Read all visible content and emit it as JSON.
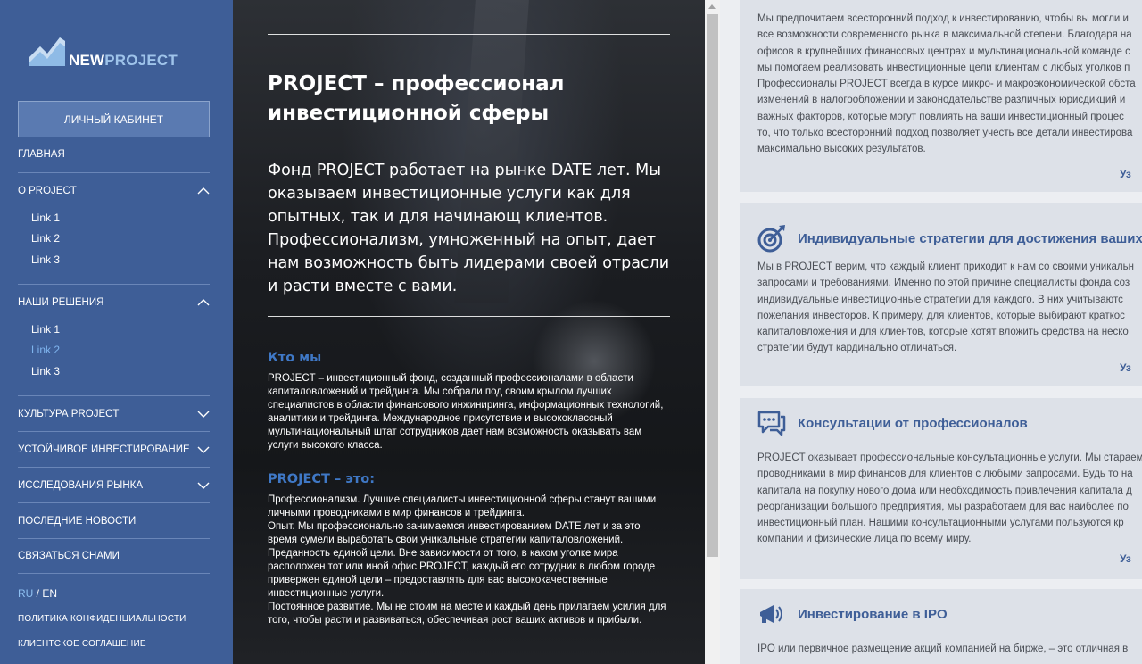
{
  "brand": {
    "part1": "NEW",
    "part2": "PROJECT"
  },
  "sidebar": {
    "cabinet_label": "ЛИЧНЫЙ КАБИНЕТ",
    "main_label": "ГЛАВНАЯ",
    "about": {
      "label": "О PROJECT",
      "links": [
        "Link 1",
        "Link 2",
        "Link 3"
      ]
    },
    "solutions": {
      "label": "НАШИ РЕШЕНИЯ",
      "links": [
        "Link 1",
        "Link 2",
        "Link 3"
      ],
      "active_index": 1
    },
    "culture_label": "КУЛЬТУРА PROJECT",
    "sustainable_label": "УСТОЙЧИВОЕ ИНВЕСТИРОВАНИЕ",
    "research_label": "ИССЛЕДОВАНИЯ РЫНКА",
    "news_label": "ПОСЛЕДНИЕ НОВОСТИ",
    "contact_label": "СВЯЗАТЬСЯ СНАМИ",
    "lang_current": "RU",
    "lang_sep": " / ",
    "lang_other": "EN",
    "privacy_label": "ПОЛИТИКА КОНФИДЕНЦИАЛЬНОСТИ",
    "agreement_label": "КЛИЕНТСКОЕ СОГЛАШЕНИЕ"
  },
  "hero": {
    "title": "PROJECT – профессионал инвестиционной сферы",
    "lead": "Фонд PROJECT работает на рынке DATE лет. Мы оказываем инвестиционные услуги как для опытных, так и для начинающ клиентов. Профессионализм, умноженный на опыт, дает нам возможность быть лидерами своей отрасли и расти вместе с вами.",
    "who_title": "Кто мы",
    "who_text": "PROJECT – инвестиционный фонд, созданный профессионалами в области капиталовложений и трейдинга. Мы собрали под своим крылом лучших специалистов в области финансового инжиниринга, информационных технологий, аналитики и трейдинга. Международное присутствие и высококлассный мультинациональный штат сотрудников дает нам возможность оказывать вам услуги высокого класса.",
    "is_title": "PROJECT – это:",
    "is_lines": [
      "Профессионализм. Лучшие специалисты инвестиционной сферы станут вашими личными проводниками в мир финансов и трейдинга.",
      "Опыт. Мы профессионально занимаемся инвестированием DATE лет и за это время сумели выработать свои уникальные стратегии капиталовложений.",
      "Преданность единой цели. Вне зависимости от того, в каком уголке мира расположен тот или иной офис PROJECT, каждый его сотрудник в любом городе привержен единой цели – предоставлять для вас высококачественные инвестиционные услуги.",
      "Постоянное развитие. Мы не стоим на месте и каждый день прилагаем усилия для того, чтобы расти и развиваться, обеспечивая рост ваших активов и прибыли."
    ]
  },
  "cards": [
    {
      "icon": "chart-icon",
      "title": "",
      "lines": [
        "Мы предпочитаем всесторонний подход к инвестированию, чтобы вы могли и",
        "все возможности современного рынка в максимальной степени. Благодаря на",
        "офисов в крупнейших финансовых центрах и мультинациональной команде с",
        "мы помогаем реализовать инвестиционные цели клиентам с любых уголков п",
        "Профессионалы PROJECT всегда в курсе микро- и макроэкономической обста",
        "изменений в налогообложении и законодательстве различных юрисдикций и",
        "важных факторов, которые могут повлиять на ваши инвестиционный процес",
        "то, что только всесторонний подход позволяет учесть все детали инвестирова",
        "максимально высоких результатов."
      ],
      "more": "Уз"
    },
    {
      "icon": "target-icon",
      "title": "Индивидуальные стратегии для достижения ваших ц",
      "lines": [
        "Мы в PROJECT верим, что каждый клиент приходит к нам со своими уникальн",
        "запросами и требованиями. Именно по этой причине специалисты фонда соз",
        "индивидуальные инвестиционные стратегии для каждого. В них учитываютс",
        "пожелания инвесторов. К примеру, для клиентов, которые выбирают краткос",
        "капиталовложения и для клиентов, которые хотят вложить средства на неско",
        "стратегии будут кардинально отличаться."
      ],
      "more": "Уз"
    },
    {
      "icon": "chat-icon",
      "title": "Консультации от профессионалов",
      "lines": [
        "PROJECT оказывает профессиональные консультационные услуги. Мы стараем",
        "проводниками в мир финансов для клиентов с любыми запросами. Будь то на",
        "капитала на покупку нового дома или необходимость привлечения капитала д",
        "реорганизации большого предприятия, мы разработаем для вас наиболее по",
        "инвестиционный план. Нашими консультационными услугами пользуются кр",
        "компании и физические лица по всему миру."
      ],
      "more": "Уз"
    },
    {
      "icon": "megaphone-icon",
      "title": "Инвестирование в IPO",
      "lines": [
        "IPO или первичное размещение акций компанией на бирже, – это отличная в"
      ],
      "more": ""
    }
  ],
  "colors": {
    "sidebar": "#3e5e97",
    "accent": "#3e5e97",
    "link_active": "#7fb4ee",
    "hero_heading": "#3f78c6"
  }
}
